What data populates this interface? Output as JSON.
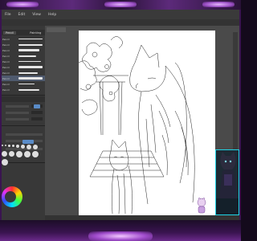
{
  "app": {
    "menu": [
      "File",
      "Edit",
      "View",
      "Help"
    ]
  },
  "brush_panel": {
    "tabs": [
      "Pencil",
      "Painting"
    ],
    "brushes": [
      {
        "label": "Pencil"
      },
      {
        "label": "Pencil"
      },
      {
        "label": "Pencil"
      },
      {
        "label": "Pencil"
      },
      {
        "label": "Pencil"
      },
      {
        "label": "Pencil"
      },
      {
        "label": "Pencil"
      },
      {
        "label": "Pencil"
      },
      {
        "label": "Pencil"
      },
      {
        "label": "Pencil"
      }
    ]
  },
  "colors": {
    "accent": "#5a8cc8",
    "webcam_border": "#20d4e6",
    "frame": "#5c2a7a"
  }
}
